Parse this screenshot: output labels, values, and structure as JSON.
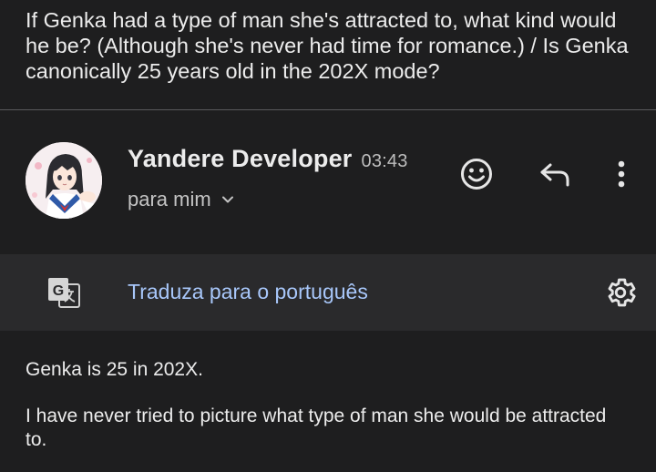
{
  "email": {
    "subject": "If Genka had a type of man she's attracted to, what kind would he be? (Although she's never had time for romance.) / Is Genka canonically 25 years old in the 202X mode?",
    "sender_name": "Yandere Developer",
    "time": "03:43",
    "recipient": "para mim",
    "body": [
      "Genka is 25 in 202X.",
      "I have never tried to picture what type of man she would be attracted to."
    ]
  },
  "actions": {
    "emoji_icon": "emoji-smile-icon",
    "reply_icon": "reply-arrow-icon",
    "more_icon": "more-vertical-icon"
  },
  "translate": {
    "label": "Traduza para o português",
    "icon": "translate-icon",
    "settings_icon": "gear-icon"
  },
  "colors": {
    "background": "#1e1e1f",
    "translate_bar": "#2a2a2c",
    "link": "#a8c7fa",
    "text": "#ececec"
  }
}
